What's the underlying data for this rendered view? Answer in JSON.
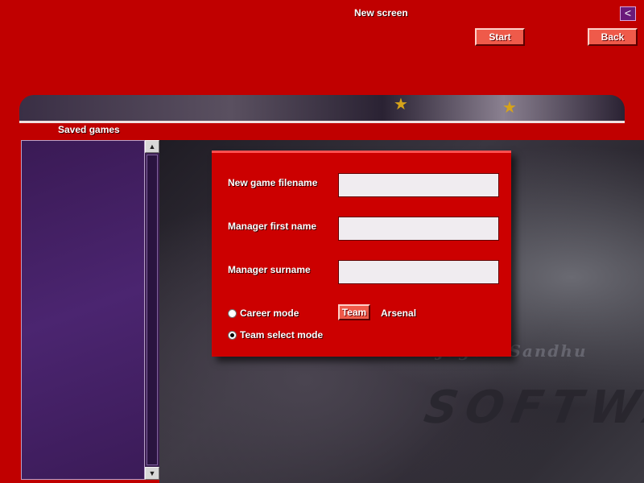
{
  "window": {
    "title": "New screen",
    "corner_button_glyph": "<"
  },
  "toolbar": {
    "start_label": "Start",
    "back_label": "Back"
  },
  "saved_games": {
    "label": "Saved games",
    "items": []
  },
  "form": {
    "filename_label": "New game filename",
    "filename_value": "",
    "first_name_label": "Manager first name",
    "first_name_value": "",
    "surname_label": "Manager surname",
    "surname_value": "",
    "modes": [
      {
        "label": "Career mode",
        "selected": false
      },
      {
        "label": "Team select mode",
        "selected": true
      }
    ],
    "team_button_label": "Team",
    "team_name": "Arsenal"
  },
  "background": {
    "signature_text": "Jagbir Sandhu",
    "logo_text": "SOFTWARE"
  },
  "icons": {
    "scroll_up": "scroll-up-arrow-icon",
    "scroll_down": "scroll-down-arrow-icon",
    "corner": "back-arrow-icon"
  },
  "colors": {
    "chrome_red": "#c00000",
    "button_red": "#ef5a4a",
    "list_purple": "#4b2570",
    "input_bg": "#f0ecf0"
  }
}
